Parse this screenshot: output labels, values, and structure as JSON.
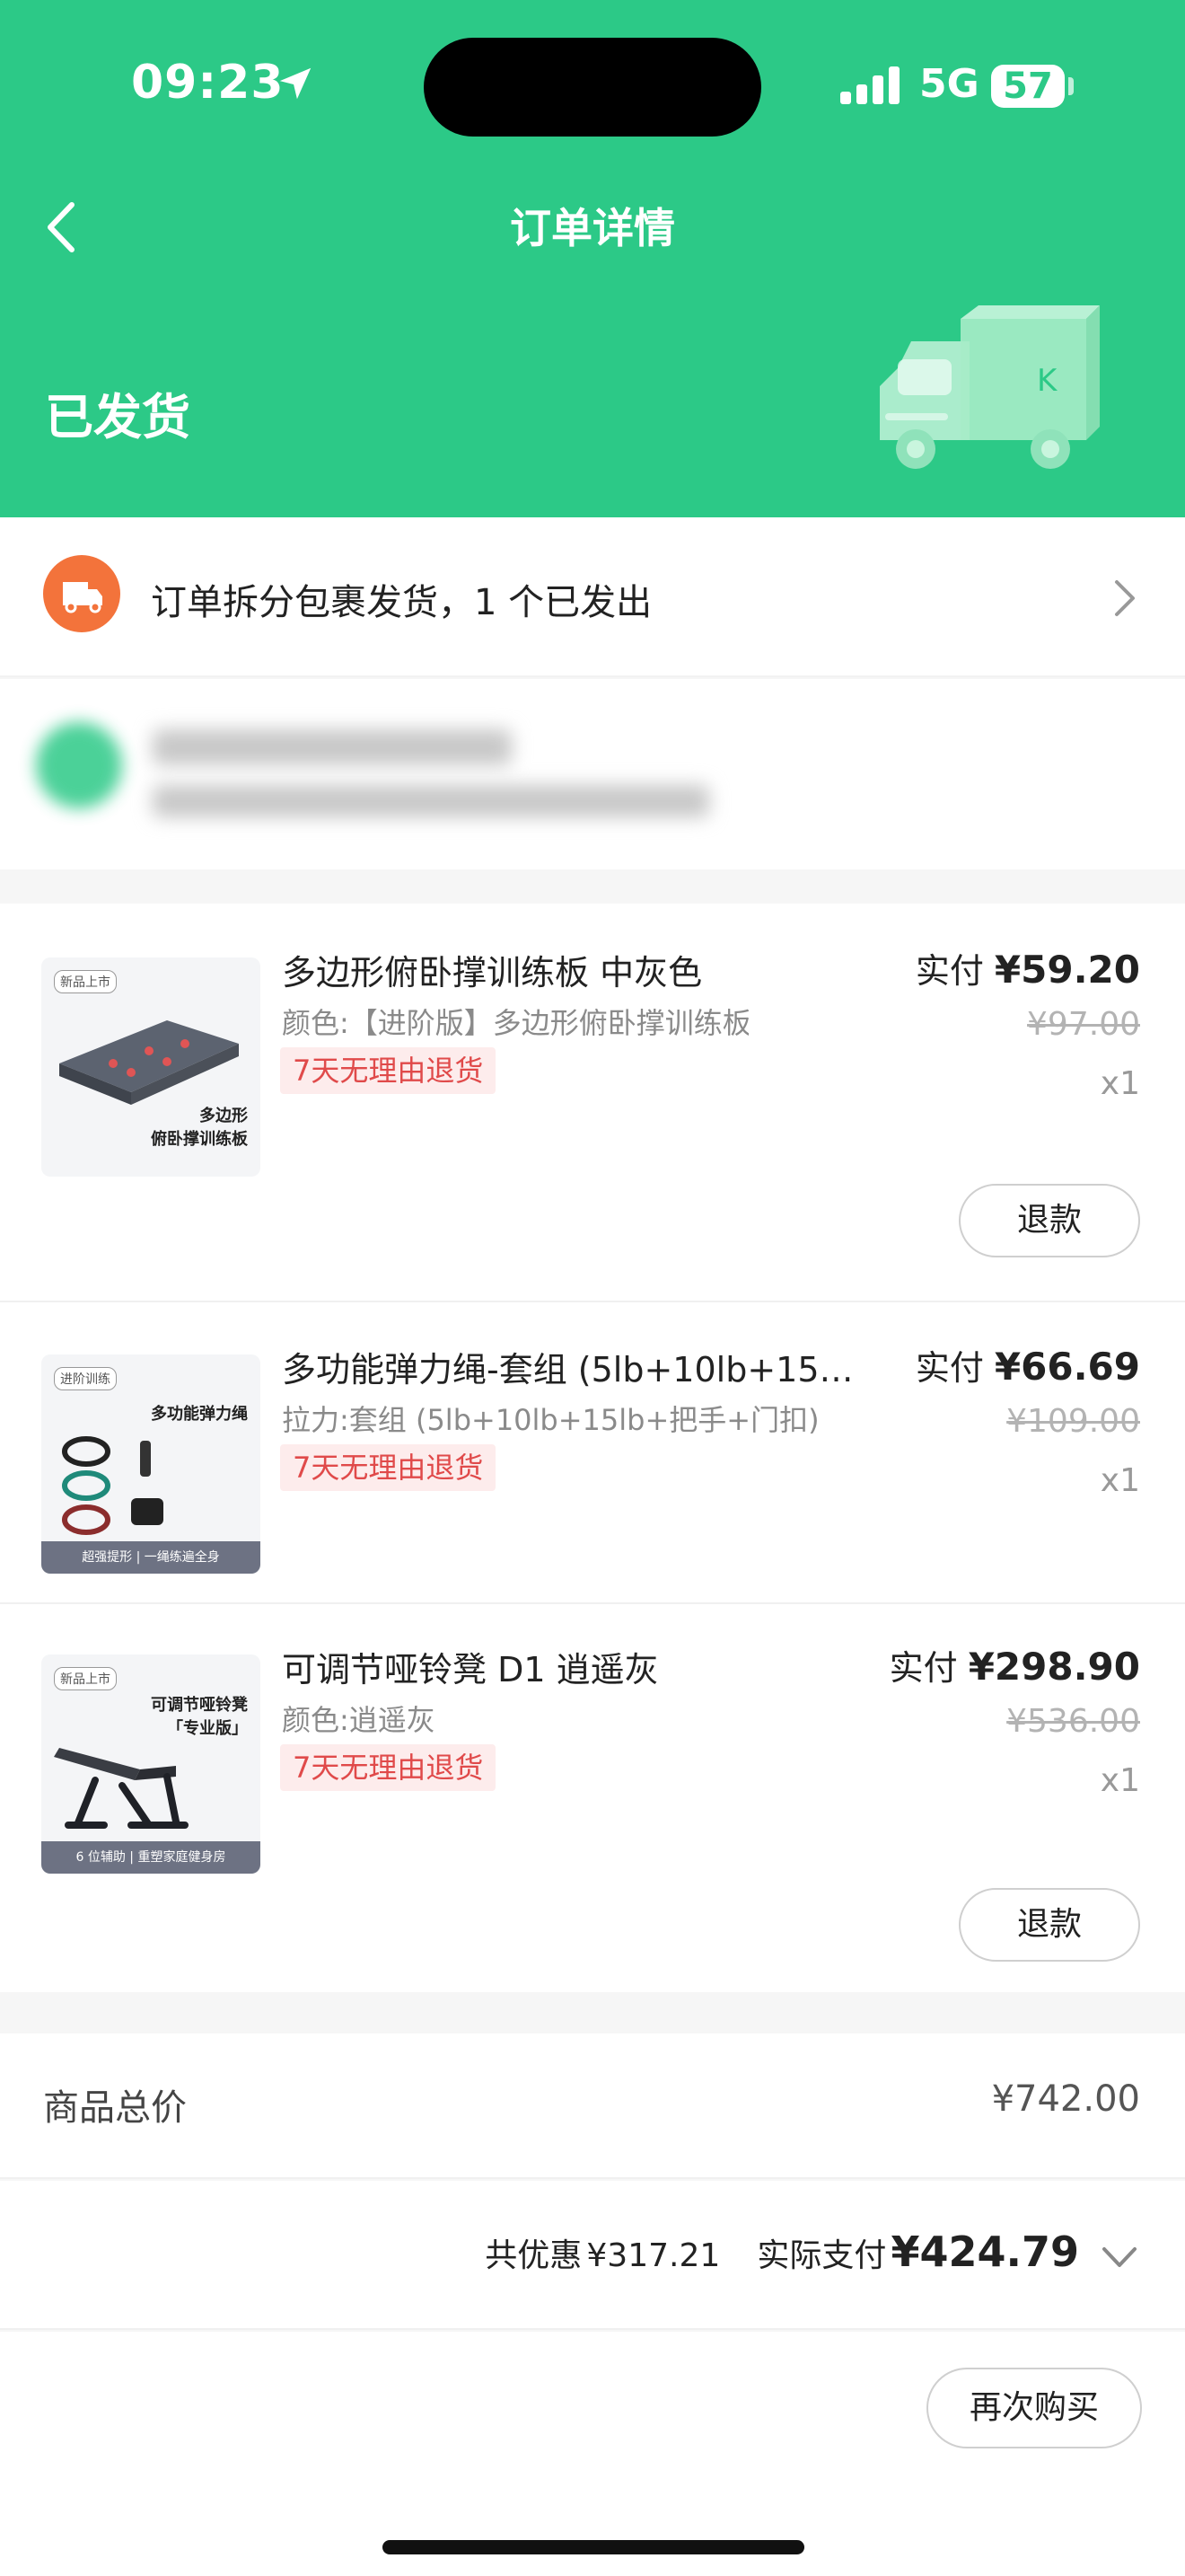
{
  "status_bar": {
    "time": "09:23",
    "network": "5G",
    "battery": "57"
  },
  "nav": {
    "title": "订单详情"
  },
  "order_status": "已发货",
  "shipping": {
    "text": "订单拆分包裹发货，1 个已发出"
  },
  "items": [
    {
      "name": "多边形俯卧撑训练板 中灰色",
      "spec": "颜色:【进阶版】多边形俯卧撑训练板",
      "badge": "7天无理由退货",
      "paid_label": "实付",
      "paid": "¥59.20",
      "original": "¥97.00",
      "qty": "x1",
      "refund": "退款",
      "thumb_tag": "新品上市",
      "thumb_caption": "多边形\n俯卧撑训练板"
    },
    {
      "name": "多功能弹力绳-套组 (5lb+10lb+15l…",
      "spec": "拉力:套组 (5lb+10lb+15lb+把手+门扣)",
      "badge": "7天无理由退货",
      "paid_label": "实付",
      "paid": "¥66.69",
      "original": "¥109.00",
      "qty": "x1",
      "thumb_tag": "进阶训练",
      "thumb_caption": "多功能弹力绳",
      "thumb_band": "超强提形 | 一绳练遍全身"
    },
    {
      "name": "可调节哑铃凳 D1 逍遥灰",
      "spec": "颜色:逍遥灰",
      "badge": "7天无理由退货",
      "paid_label": "实付",
      "paid": "¥298.90",
      "original": "¥536.00",
      "qty": "x1",
      "refund": "退款",
      "thumb_tag": "新品上市",
      "thumb_caption": "可调节哑铃凳\n「专业版」",
      "thumb_band": "6 位辅助 | 重塑家庭健身房"
    }
  ],
  "summary": {
    "total_label": "商品总价",
    "total_value": "¥742.00",
    "discount_label": "共优惠",
    "discount_value": "¥317.21",
    "actual_label": "实际支付",
    "actual_value": "¥424.79"
  },
  "footer": {
    "rebuy": "再次购买"
  },
  "colors": {
    "brand": "#2cc987",
    "ship_icon": "#f3733b",
    "badge_text": "#e04a4a"
  }
}
